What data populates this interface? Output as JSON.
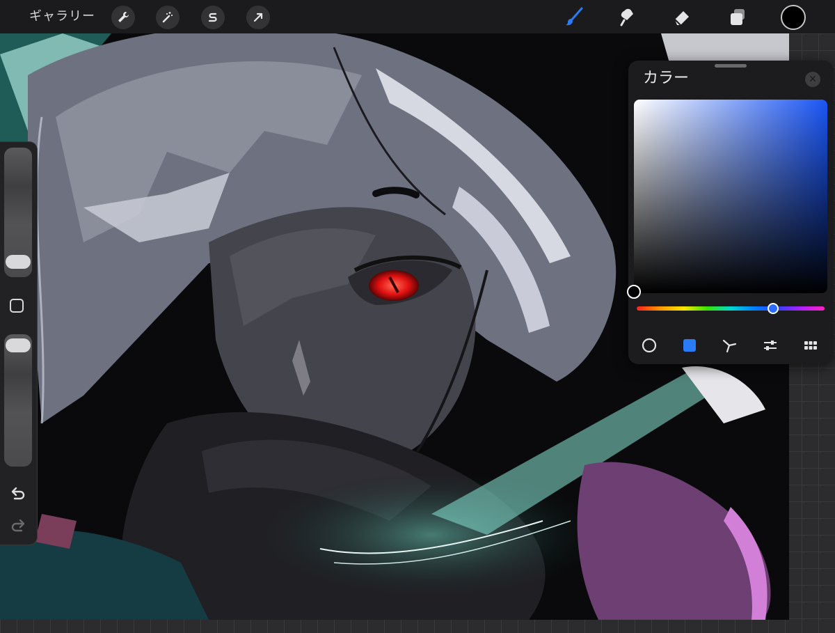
{
  "toolbar": {
    "gallery_label": "ギャラリー",
    "left_tools": [
      "wrench-icon",
      "magic-wand-icon",
      "selection-s-icon",
      "transform-arrow-icon"
    ],
    "right_tools": [
      "brush-icon",
      "smudge-icon",
      "eraser-icon",
      "layers-icon"
    ],
    "current_color": "#000000",
    "active_tool": "brush",
    "active_tool_color": "#2a7cf6"
  },
  "sidebar": {
    "brush_size_level": 0.85,
    "opacity_level": 0.05,
    "icons": [
      "modify-square-icon",
      "undo-icon",
      "redo-icon"
    ]
  },
  "color_panel": {
    "title": "カラー",
    "hue_color": "#1a55f5",
    "hue_level": 0.69,
    "modes": [
      "disc",
      "classic",
      "harmony",
      "value",
      "palettes"
    ],
    "active_mode": "classic",
    "accent": "#2a7cf6"
  }
}
